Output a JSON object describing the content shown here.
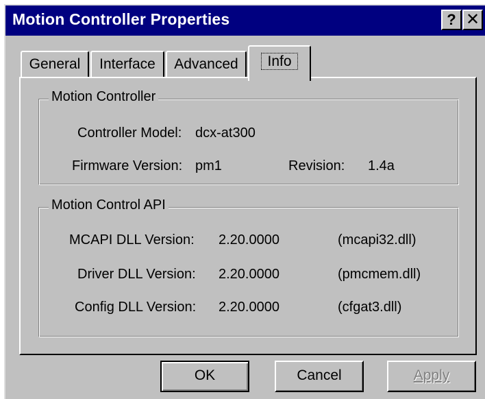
{
  "window": {
    "title": "Motion Controller Properties",
    "help_glyph": "?",
    "close_glyph": "✕"
  },
  "tabs": [
    {
      "label": "General",
      "selected": false
    },
    {
      "label": "Interface",
      "selected": false
    },
    {
      "label": "Advanced",
      "selected": false
    },
    {
      "label": "Info",
      "selected": true
    }
  ],
  "motion_controller": {
    "legend": "Motion Controller",
    "model_label": "Controller Model:",
    "model_value": "dcx-at300",
    "firmware_label": "Firmware Version:",
    "firmware_value": "pm1",
    "revision_label": "Revision:",
    "revision_value": "1.4a"
  },
  "motion_control_api": {
    "legend": "Motion Control API",
    "rows": [
      {
        "label": "MCAPI DLL Version:",
        "version": "2.20.0000",
        "file": "(mcapi32.dll)"
      },
      {
        "label": "Driver DLL Version:",
        "version": "2.20.0000",
        "file": "(pmcmem.dll)"
      },
      {
        "label": "Config DLL Version:",
        "version": "2.20.0000",
        "file": "(cfgat3.dll)"
      }
    ]
  },
  "buttons": {
    "ok": "OK",
    "cancel": "Cancel",
    "apply": "Apply"
  },
  "colors": {
    "titlebar": "#000080",
    "face": "#c0c0c0",
    "disabled_text": "#808080"
  }
}
